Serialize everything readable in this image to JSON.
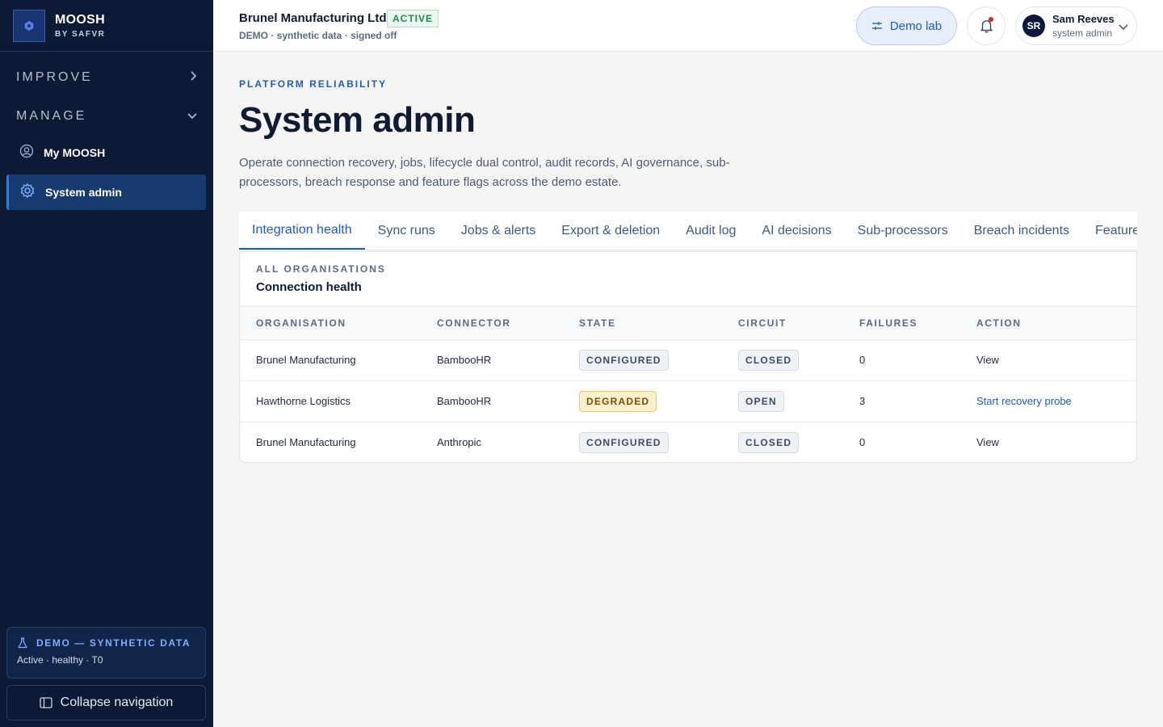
{
  "brand": {
    "name": "MOOSH",
    "sub": "BY SAFVR"
  },
  "sidebar": {
    "sections": [
      {
        "label": "IMPROVE",
        "expanded": false
      },
      {
        "label": "MANAGE",
        "expanded": true
      }
    ],
    "items": [
      {
        "label": "My MOOSH",
        "icon": "user-circle-icon",
        "active": false
      },
      {
        "label": "System admin",
        "icon": "gear-icon",
        "active": true
      }
    ],
    "demo": {
      "title": "DEMO — SYNTHETIC DATA",
      "status": "Active · healthy · T0"
    },
    "collapse_label": "Collapse navigation"
  },
  "header": {
    "org_name": "Brunel Manufacturing Ltd",
    "org_status": "ACTIVE",
    "org_meta": "DEMO · synthetic data · signed off",
    "demo_lab_label": "Demo lab",
    "user": {
      "initials": "SR",
      "name": "Sam Reeves",
      "role": "system admin"
    }
  },
  "page": {
    "eyebrow": "PLATFORM RELIABILITY",
    "title": "System admin",
    "description": "Operate connection recovery, jobs, lifecycle dual control, audit records, AI governance, sub-processors, breach response and feature flags across the demo estate."
  },
  "tabs": [
    {
      "label": "Integration health",
      "active": true
    },
    {
      "label": "Sync runs",
      "active": false
    },
    {
      "label": "Jobs & alerts",
      "active": false
    },
    {
      "label": "Export & deletion",
      "active": false
    },
    {
      "label": "Audit log",
      "active": false
    },
    {
      "label": "AI decisions",
      "active": false
    },
    {
      "label": "Sub-processors",
      "active": false
    },
    {
      "label": "Breach incidents",
      "active": false
    },
    {
      "label": "Feature flags",
      "active": false
    }
  ],
  "panel": {
    "eyebrow": "ALL ORGANISATIONS",
    "title": "Connection health",
    "columns": [
      "ORGANISATION",
      "CONNECTOR",
      "STATE",
      "CIRCUIT",
      "FAILURES",
      "ACTION"
    ],
    "rows": [
      {
        "organisation": "Brunel Manufacturing",
        "connector": "BambooHR",
        "state": "CONFIGURED",
        "circuit": "CLOSED",
        "failures": "0",
        "action": "View"
      },
      {
        "organisation": "Hawthorne Logistics",
        "connector": "BambooHR",
        "state": "DEGRADED",
        "circuit": "OPEN",
        "failures": "3",
        "action": "Start recovery probe"
      },
      {
        "organisation": "Brunel Manufacturing",
        "connector": "Anthropic",
        "state": "CONFIGURED",
        "circuit": "CLOSED",
        "failures": "0",
        "action": "View"
      }
    ]
  },
  "colors": {
    "sidebar_bg": "#0c1a36",
    "accent": "#1c5bc2",
    "active_badge": "#1f8a4c",
    "degraded": "#7a4d05",
    "notification_dot": "#e02424"
  }
}
